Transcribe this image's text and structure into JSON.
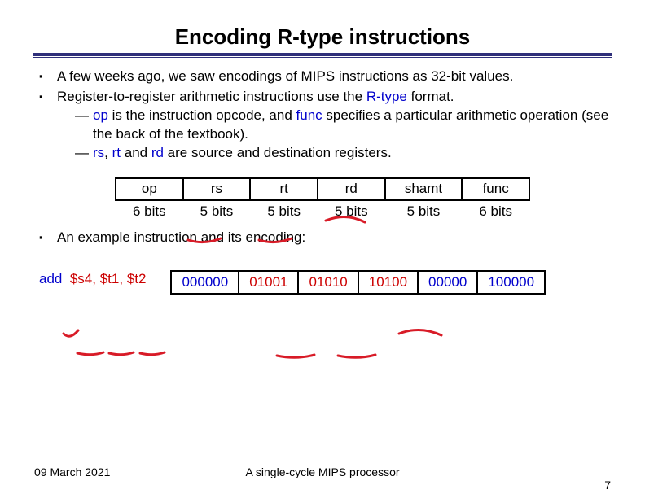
{
  "title": "Encoding R-type instructions",
  "bullets": {
    "b1": "A few weeks ago, we saw encodings of MIPS instructions as 32-bit values.",
    "b2_pre": "Register-to-register arithmetic instructions use the ",
    "b2_rtype": "R-type",
    "b2_post": " format.",
    "s1_op": "op",
    "s1_mid": " is the instruction opcode, and ",
    "s1_func": "func",
    "s1_tail": " specifies a particular arithmetic operation (see the back of the textbook).",
    "s2_rs": "rs",
    "s2_c1": ", ",
    "s2_rt": "rt",
    "s2_c2": " and ",
    "s2_rd": "rd",
    "s2_tail": " are source and destination registers.",
    "b3": "An example instruction and its encoding:"
  },
  "format_fields": [
    "op",
    "rs",
    "rt",
    "rd",
    "shamt",
    "func"
  ],
  "format_bits": [
    "6 bits",
    "5 bits",
    "5 bits",
    "5 bits",
    "5 bits",
    "6 bits"
  ],
  "example_asm": {
    "mnemonic": "add",
    "args": [
      "$s4",
      "$t1",
      "$t2"
    ]
  },
  "example_encoding": [
    "000000",
    "01001",
    "01010",
    "10100",
    "00000",
    "100000"
  ],
  "footer": {
    "date": "09 March 2021",
    "center": "A single-cycle MIPS processor",
    "page": "7"
  },
  "chart_data": {
    "type": "table",
    "title": "R-type instruction field layout",
    "columns": [
      "op",
      "rs",
      "rt",
      "rd",
      "shamt",
      "func"
    ],
    "widths_bits": [
      6,
      5,
      5,
      5,
      5,
      6
    ],
    "example": {
      "assembly": "add $s4, $t1, $t2",
      "fields": {
        "op": "000000",
        "rs": "01001",
        "rt": "01010",
        "rd": "10100",
        "shamt": "00000",
        "func": "100000"
      }
    }
  }
}
